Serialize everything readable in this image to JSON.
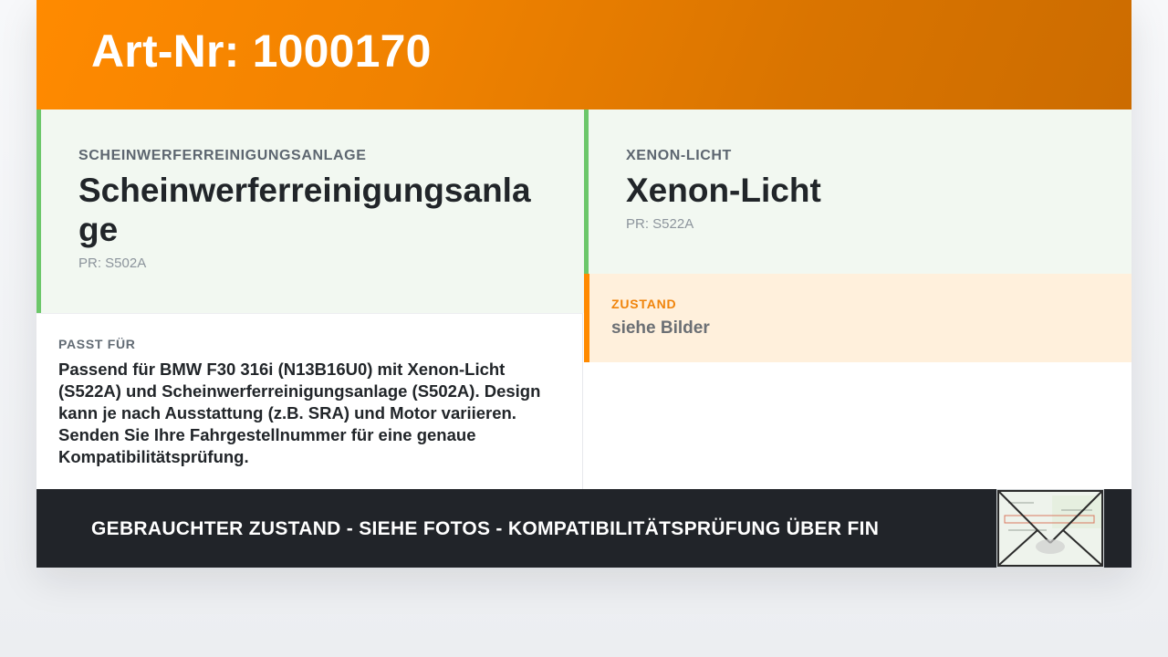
{
  "header": {
    "title": "Art-Nr: 1000170"
  },
  "features": [
    {
      "label": "SCHEINWERFERREINIGUNGSANLAGE",
      "title": "Scheinwerferreinigungsanlage",
      "pr": "PR: S502A"
    },
    {
      "label": "XENON-LICHT",
      "title": "Xenon-Licht",
      "pr": "PR: S522A"
    }
  ],
  "compatibility": {
    "label": "PASST FÜR",
    "text": "Passend für BMW F30 316i (N13B16U0) mit Xenon-Licht (S522A) und Scheinwerferreinigungsanlage (S502A). Design kann je nach Ausstattung (z.B. SRA) und Motor variieren. Senden Sie Ihre Fahrgestellnummer für eine genaue Kompatibilitätsprüfung."
  },
  "condition": {
    "label": "ZUSTAND",
    "value": "siehe Bilder"
  },
  "footer": {
    "text": "GEBRAUCHTER ZUSTAND - SIEHE FOTOS - KOMPATIBILITÄTSPRÜFUNG ÜBER FIN",
    "thumbnail": {
      "icon": "vehicle-registration-document-icon"
    }
  },
  "colors": {
    "header_orange": "#f08200",
    "feature_accent_green": "#6cc76a",
    "feature_background": "#f2f8f1",
    "condition_accent": "#ff8a00",
    "condition_background": "#fff0dc",
    "footer_background": "#212429"
  }
}
